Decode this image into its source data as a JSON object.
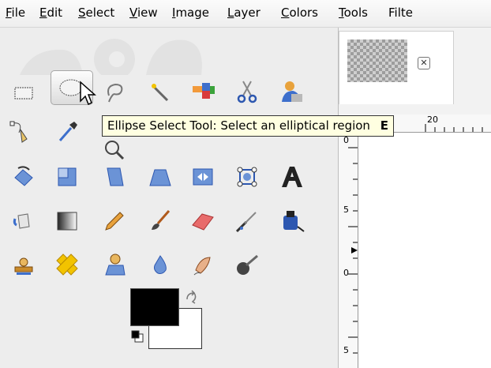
{
  "menubar": {
    "items": [
      {
        "mnemonic": "F",
        "rest": "ile"
      },
      {
        "mnemonic": "E",
        "rest": "dit"
      },
      {
        "mnemonic": "S",
        "rest": "elect"
      },
      {
        "mnemonic": "V",
        "rest": "iew"
      },
      {
        "mnemonic": "I",
        "rest": "mage"
      },
      {
        "mnemonic": "L",
        "rest": "ayer"
      },
      {
        "mnemonic": "C",
        "rest": "olors"
      },
      {
        "mnemonic": "T",
        "rest": "ools"
      },
      {
        "mnemonic": "",
        "rest": "Filte"
      }
    ]
  },
  "tooltip": {
    "text": "Ellipse Select Tool: Select an elliptical region",
    "shortcut": "E"
  },
  "rulers": {
    "h_label": "20",
    "v_labels": [
      "0",
      "5",
      "0",
      "5"
    ]
  },
  "image_tab": {
    "close_glyph": "✕"
  },
  "tools": [
    "rect-select",
    "ellipse-select",
    "free-select",
    "fuzzy-select",
    "select-by-color",
    "scissors-select",
    "foreground-select",
    "paths",
    "color-picker",
    "zoom",
    "measure",
    "move",
    "align",
    "text-tool-hidden",
    "rotate",
    "scale",
    "shear",
    "perspective",
    "flip",
    "cage-transform",
    "text",
    "bucket-fill",
    "blend",
    "pencil",
    "paintbrush",
    "eraser",
    "airbrush",
    "ink",
    "clone",
    "heal",
    "perspective-clone",
    "blur-sharpen",
    "smudge",
    "dodge-burn"
  ],
  "colors": {
    "foreground": "#000000",
    "background": "#ffffff"
  }
}
